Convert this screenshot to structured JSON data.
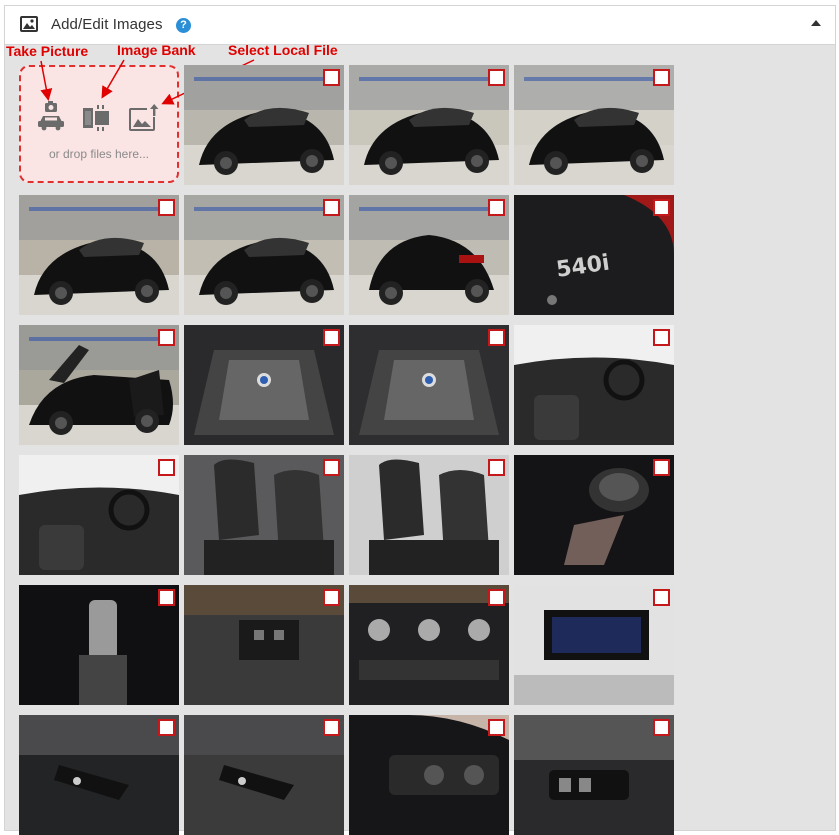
{
  "header": {
    "title": "Add/Edit Images",
    "help_glyph": "?"
  },
  "annotations": {
    "take_picture": "Take Picture",
    "image_bank": "Image Bank",
    "select_local_file": "Select Local File"
  },
  "dropzone": {
    "text": "or drop files here..."
  },
  "thumbnails": [
    {
      "scene": "car-front",
      "bg": "#b9b7ad",
      "label": ""
    },
    {
      "scene": "car-front",
      "bg": "#c9c6bc",
      "label": ""
    },
    {
      "scene": "car-front",
      "bg": "#d3d1c8",
      "label": ""
    },
    {
      "scene": "car-side",
      "bg": "#b8b3a6",
      "label": ""
    },
    {
      "scene": "car-side",
      "bg": "#c2beb3",
      "label": ""
    },
    {
      "scene": "car-rear",
      "bg": "#bfbcb4",
      "label": ""
    },
    {
      "scene": "badge",
      "bg": "#1c1c1e",
      "label": "540i"
    },
    {
      "scene": "car-open",
      "bg": "#aaa79d",
      "label": ""
    },
    {
      "scene": "engine",
      "bg": "#2a2a2c",
      "label": ""
    },
    {
      "scene": "engine",
      "bg": "#2e2e30",
      "label": ""
    },
    {
      "scene": "dashboard",
      "bg": "#d9d9d9",
      "label": ""
    },
    {
      "scene": "interior",
      "bg": "#d6d6d6",
      "label": ""
    },
    {
      "scene": "seat",
      "bg": "#5a5a5c",
      "label": ""
    },
    {
      "scene": "seat",
      "bg": "#cfcfcf",
      "label": ""
    },
    {
      "scene": "knob",
      "bg": "#141416",
      "label": ""
    },
    {
      "scene": "shifter",
      "bg": "#101012",
      "label": ""
    },
    {
      "scene": "console",
      "bg": "#3a3a3a",
      "label": ""
    },
    {
      "scene": "climate",
      "bg": "#202022",
      "label": ""
    },
    {
      "scene": "screen",
      "bg": "#e2e2e2",
      "label": ""
    },
    {
      "scene": "stalk",
      "bg": "#232426",
      "label": ""
    },
    {
      "scene": "stalk",
      "bg": "#3b3b3c",
      "label": ""
    },
    {
      "scene": "switch",
      "bg": "#161618",
      "label": ""
    },
    {
      "scene": "door",
      "bg": "#2a2a2c",
      "label": ""
    }
  ],
  "icons": {
    "header": "image-icon",
    "help": "help-icon",
    "collapse": "chevron-up-icon",
    "take_picture": "camera-car-icon",
    "image_bank": "image-bank-icon",
    "select_local_file": "image-upload-icon"
  },
  "colors": {
    "accent_red": "#e00000",
    "checkbox_border": "#c4181a",
    "help_blue": "#2a8fd6",
    "dropzone_bg": "#fbe4e4"
  }
}
